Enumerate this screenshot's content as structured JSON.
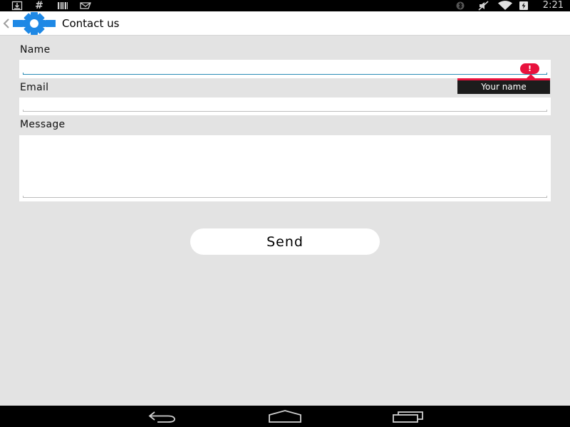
{
  "status_bar": {
    "time": "2:21",
    "left_icons": [
      "download-icon",
      "hash-icon",
      "barcode-icon",
      "gmail-icon"
    ],
    "right_icons": [
      "bluetooth-icon",
      "mute-icon",
      "wifi-icon",
      "battery-charging-icon"
    ],
    "hash_glyph": "#"
  },
  "action_bar": {
    "title": "Contact us",
    "icon": "gear-icon",
    "accent_color": "#1e88e5"
  },
  "form": {
    "name_label": "Name",
    "name_value": "",
    "email_label": "Email",
    "email_value": "",
    "message_label": "Message",
    "message_value": "",
    "error_glyph": "!",
    "error_message": "Your name",
    "error_color": "#e8123d",
    "send_label": "Send"
  },
  "nav_bar": {
    "buttons": [
      "back-icon",
      "home-icon",
      "recent-apps-icon"
    ]
  }
}
